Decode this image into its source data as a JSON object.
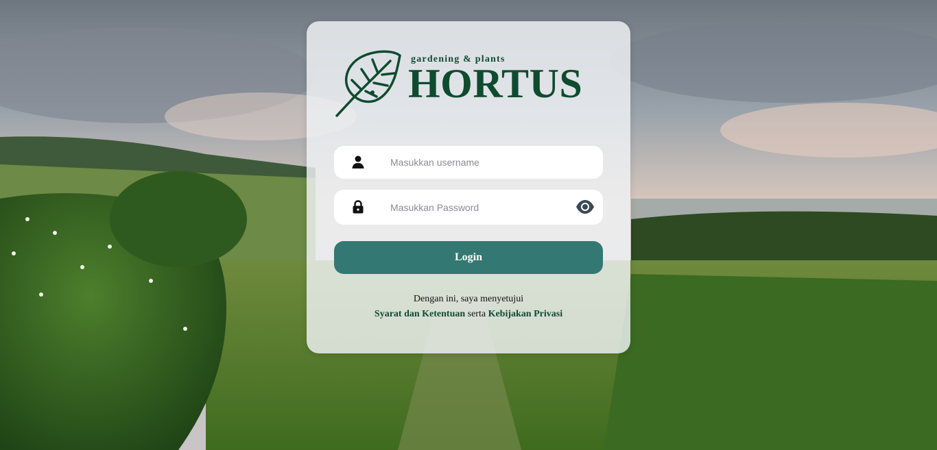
{
  "brand": {
    "tagline": "gardening & plants",
    "name": "HORTUS",
    "logo_icon": "monstera-leaf-icon",
    "color": "#0f4b2f"
  },
  "form": {
    "username": {
      "icon": "user-icon",
      "placeholder": "Masukkan username",
      "value": ""
    },
    "password": {
      "icon": "lock-icon",
      "placeholder": "Masukkan Password",
      "value": "",
      "toggle_icon": "eye-icon"
    },
    "login_label": "Login",
    "login_color": "#337873"
  },
  "agreement": {
    "text": "Dengan ini, saya menyetujui",
    "terms_link": "Syarat dan Ketentuan",
    "connector": "serta",
    "privacy_link": "Kebijakan Privasi"
  }
}
